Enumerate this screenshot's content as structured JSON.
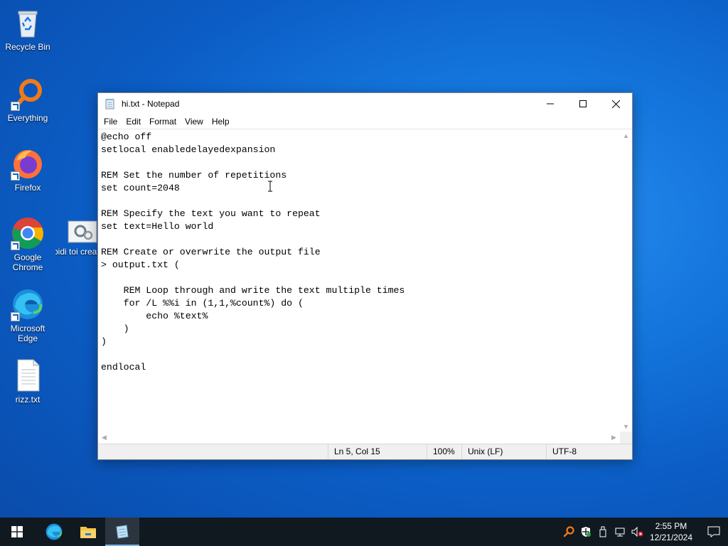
{
  "desktop": {
    "icons": [
      {
        "label": "Recycle Bin"
      },
      {
        "label": "Everything"
      },
      {
        "label": "Firefox"
      },
      {
        "label": "Google Chrome"
      },
      {
        "label": "skibidi toi creator.b..."
      },
      {
        "label": "Microsoft Edge"
      },
      {
        "label": "rizz.txt"
      }
    ]
  },
  "notepad": {
    "title": "hi.txt - Notepad",
    "menu": [
      "File",
      "Edit",
      "Format",
      "View",
      "Help"
    ],
    "content": "@echo off\nsetlocal enabledelayedexpansion\n\nREM Set the number of repetitions\nset count=2048\n\nREM Specify the text you want to repeat\nset text=Hello world\n\nREM Create or overwrite the output file\n> output.txt (\n\n    REM Loop through and write the text multiple times\n    for /L %%i in (1,1,%count%) do (\n        echo %text%\n    )\n)\n\nendlocal",
    "status": {
      "position": "Ln 5, Col 15",
      "zoom": "100%",
      "line_endings": "Unix (LF)",
      "encoding": "UTF-8"
    }
  },
  "taskbar": {
    "time": "2:55 PM",
    "date": "12/21/2024"
  },
  "colors": {
    "desktop_blue": "#1476dd",
    "taskbar": "#101820",
    "status_bar": "#f0f0f0"
  }
}
